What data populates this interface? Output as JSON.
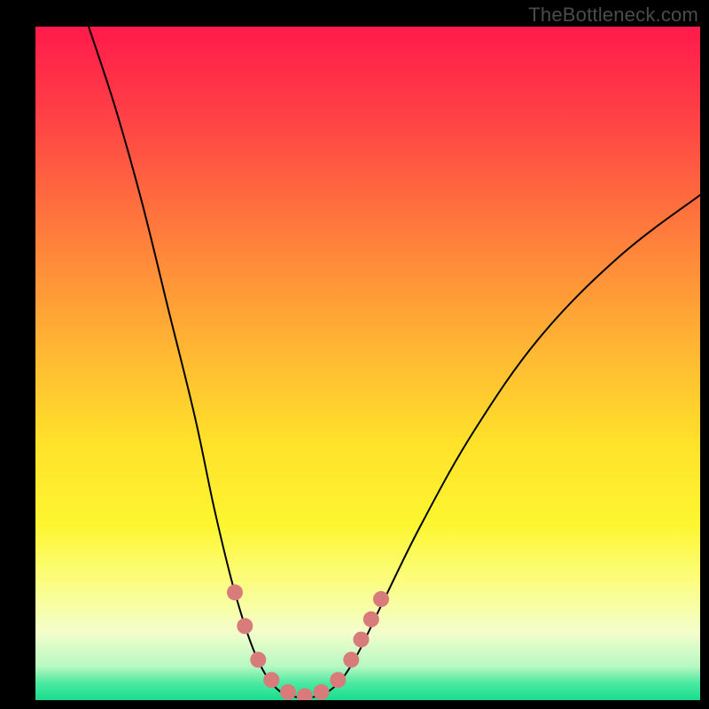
{
  "watermark": "TheBottleneck.com",
  "chart_data": {
    "type": "line",
    "title": "",
    "xlabel": "",
    "ylabel": "",
    "xlim": [
      0,
      100
    ],
    "ylim": [
      0,
      100
    ],
    "grid": false,
    "legend": false,
    "background": {
      "gradient_stops": [
        {
          "offset": 0.0,
          "color": "#ff1a4b"
        },
        {
          "offset": 0.12,
          "color": "#ff3d46"
        },
        {
          "offset": 0.3,
          "color": "#ff7a3c"
        },
        {
          "offset": 0.48,
          "color": "#ffb733"
        },
        {
          "offset": 0.62,
          "color": "#ffe22a"
        },
        {
          "offset": 0.74,
          "color": "#fdf631"
        },
        {
          "offset": 0.82,
          "color": "#fcfd7d"
        },
        {
          "offset": 0.9,
          "color": "#f3fecb"
        },
        {
          "offset": 0.95,
          "color": "#b7f8c2"
        },
        {
          "offset": 0.975,
          "color": "#4be9a0"
        },
        {
          "offset": 1.0,
          "color": "#19dd8f"
        }
      ]
    },
    "series": [
      {
        "name": "bottleneck-curve",
        "stroke": "#000000",
        "stroke_width": 2,
        "fill": "none",
        "points": [
          {
            "x": 8,
            "y": 100
          },
          {
            "x": 12,
            "y": 88
          },
          {
            "x": 16,
            "y": 74
          },
          {
            "x": 20,
            "y": 58
          },
          {
            "x": 24,
            "y": 42
          },
          {
            "x": 27,
            "y": 28
          },
          {
            "x": 30,
            "y": 16
          },
          {
            "x": 33,
            "y": 7
          },
          {
            "x": 36,
            "y": 2
          },
          {
            "x": 39,
            "y": 0.5
          },
          {
            "x": 42,
            "y": 0.5
          },
          {
            "x": 45,
            "y": 2
          },
          {
            "x": 48,
            "y": 6
          },
          {
            "x": 52,
            "y": 14
          },
          {
            "x": 58,
            "y": 26
          },
          {
            "x": 66,
            "y": 40
          },
          {
            "x": 76,
            "y": 54
          },
          {
            "x": 88,
            "y": 66
          },
          {
            "x": 100,
            "y": 75
          }
        ]
      }
    ],
    "markers": {
      "name": "highlight-dots",
      "color": "#d87b7b",
      "radius": 9,
      "points": [
        {
          "x": 30.0,
          "y": 16.0
        },
        {
          "x": 31.5,
          "y": 11.0
        },
        {
          "x": 33.5,
          "y": 6.0
        },
        {
          "x": 35.5,
          "y": 3.0
        },
        {
          "x": 38.0,
          "y": 1.2
        },
        {
          "x": 40.5,
          "y": 0.6
        },
        {
          "x": 43.0,
          "y": 1.2
        },
        {
          "x": 45.5,
          "y": 3.0
        },
        {
          "x": 47.5,
          "y": 6.0
        },
        {
          "x": 49.0,
          "y": 9.0
        },
        {
          "x": 50.5,
          "y": 12.0
        },
        {
          "x": 52.0,
          "y": 15.0
        }
      ]
    }
  }
}
